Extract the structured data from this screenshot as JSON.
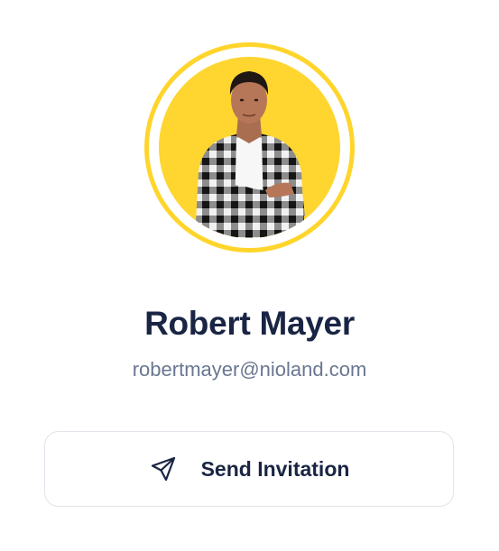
{
  "profile": {
    "name": "Robert Mayer",
    "email": "robertmayer@nioland.com"
  },
  "actions": {
    "send_invitation_label": "Send Invitation",
    "send_icon": "send-icon"
  },
  "colors": {
    "ring": "#ffd52c",
    "avatar_bg": "#ffd530",
    "text_primary": "#1a2544",
    "text_secondary": "#6a7792",
    "button_border": "#e1e4ea"
  }
}
